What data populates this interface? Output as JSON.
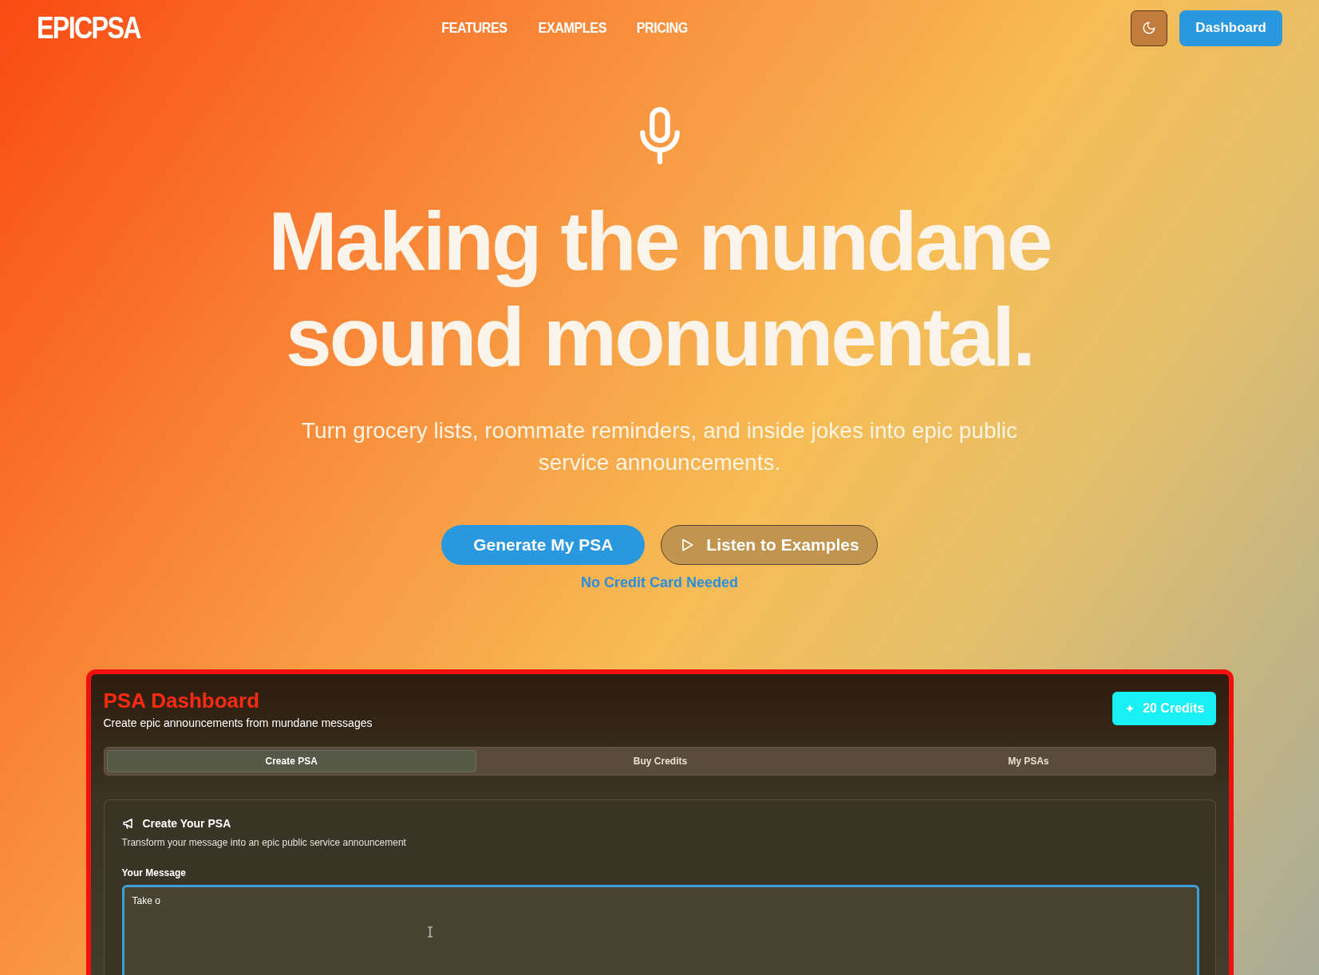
{
  "nav": {
    "logo": "EPICPSA",
    "links": [
      "FEATURES",
      "EXAMPLES",
      "PRICING"
    ],
    "dashboard_button": "Dashboard"
  },
  "hero": {
    "headline_lines": [
      "Making the mundane",
      "sound monumental."
    ],
    "subtitle": "Turn grocery lists, roommate reminders, and inside jokes into epic public service announcements.",
    "primary_button": "Generate My PSA",
    "secondary_button": "Listen to Examples",
    "note": "No Credit Card Needed"
  },
  "dashboard": {
    "title": "PSA Dashboard",
    "subtitle": "Create epic announcements from mundane messages",
    "credits": "20 Credits",
    "tabs": [
      {
        "label": "Create PSA",
        "selected": true
      },
      {
        "label": "Buy Credits",
        "selected": false
      },
      {
        "label": "My PSAs",
        "selected": false
      }
    ],
    "card": {
      "title": "Create Your PSA",
      "description": "Transform your message into an epic public service announcement",
      "field_label": "Your Message",
      "value": "Take o"
    }
  }
}
